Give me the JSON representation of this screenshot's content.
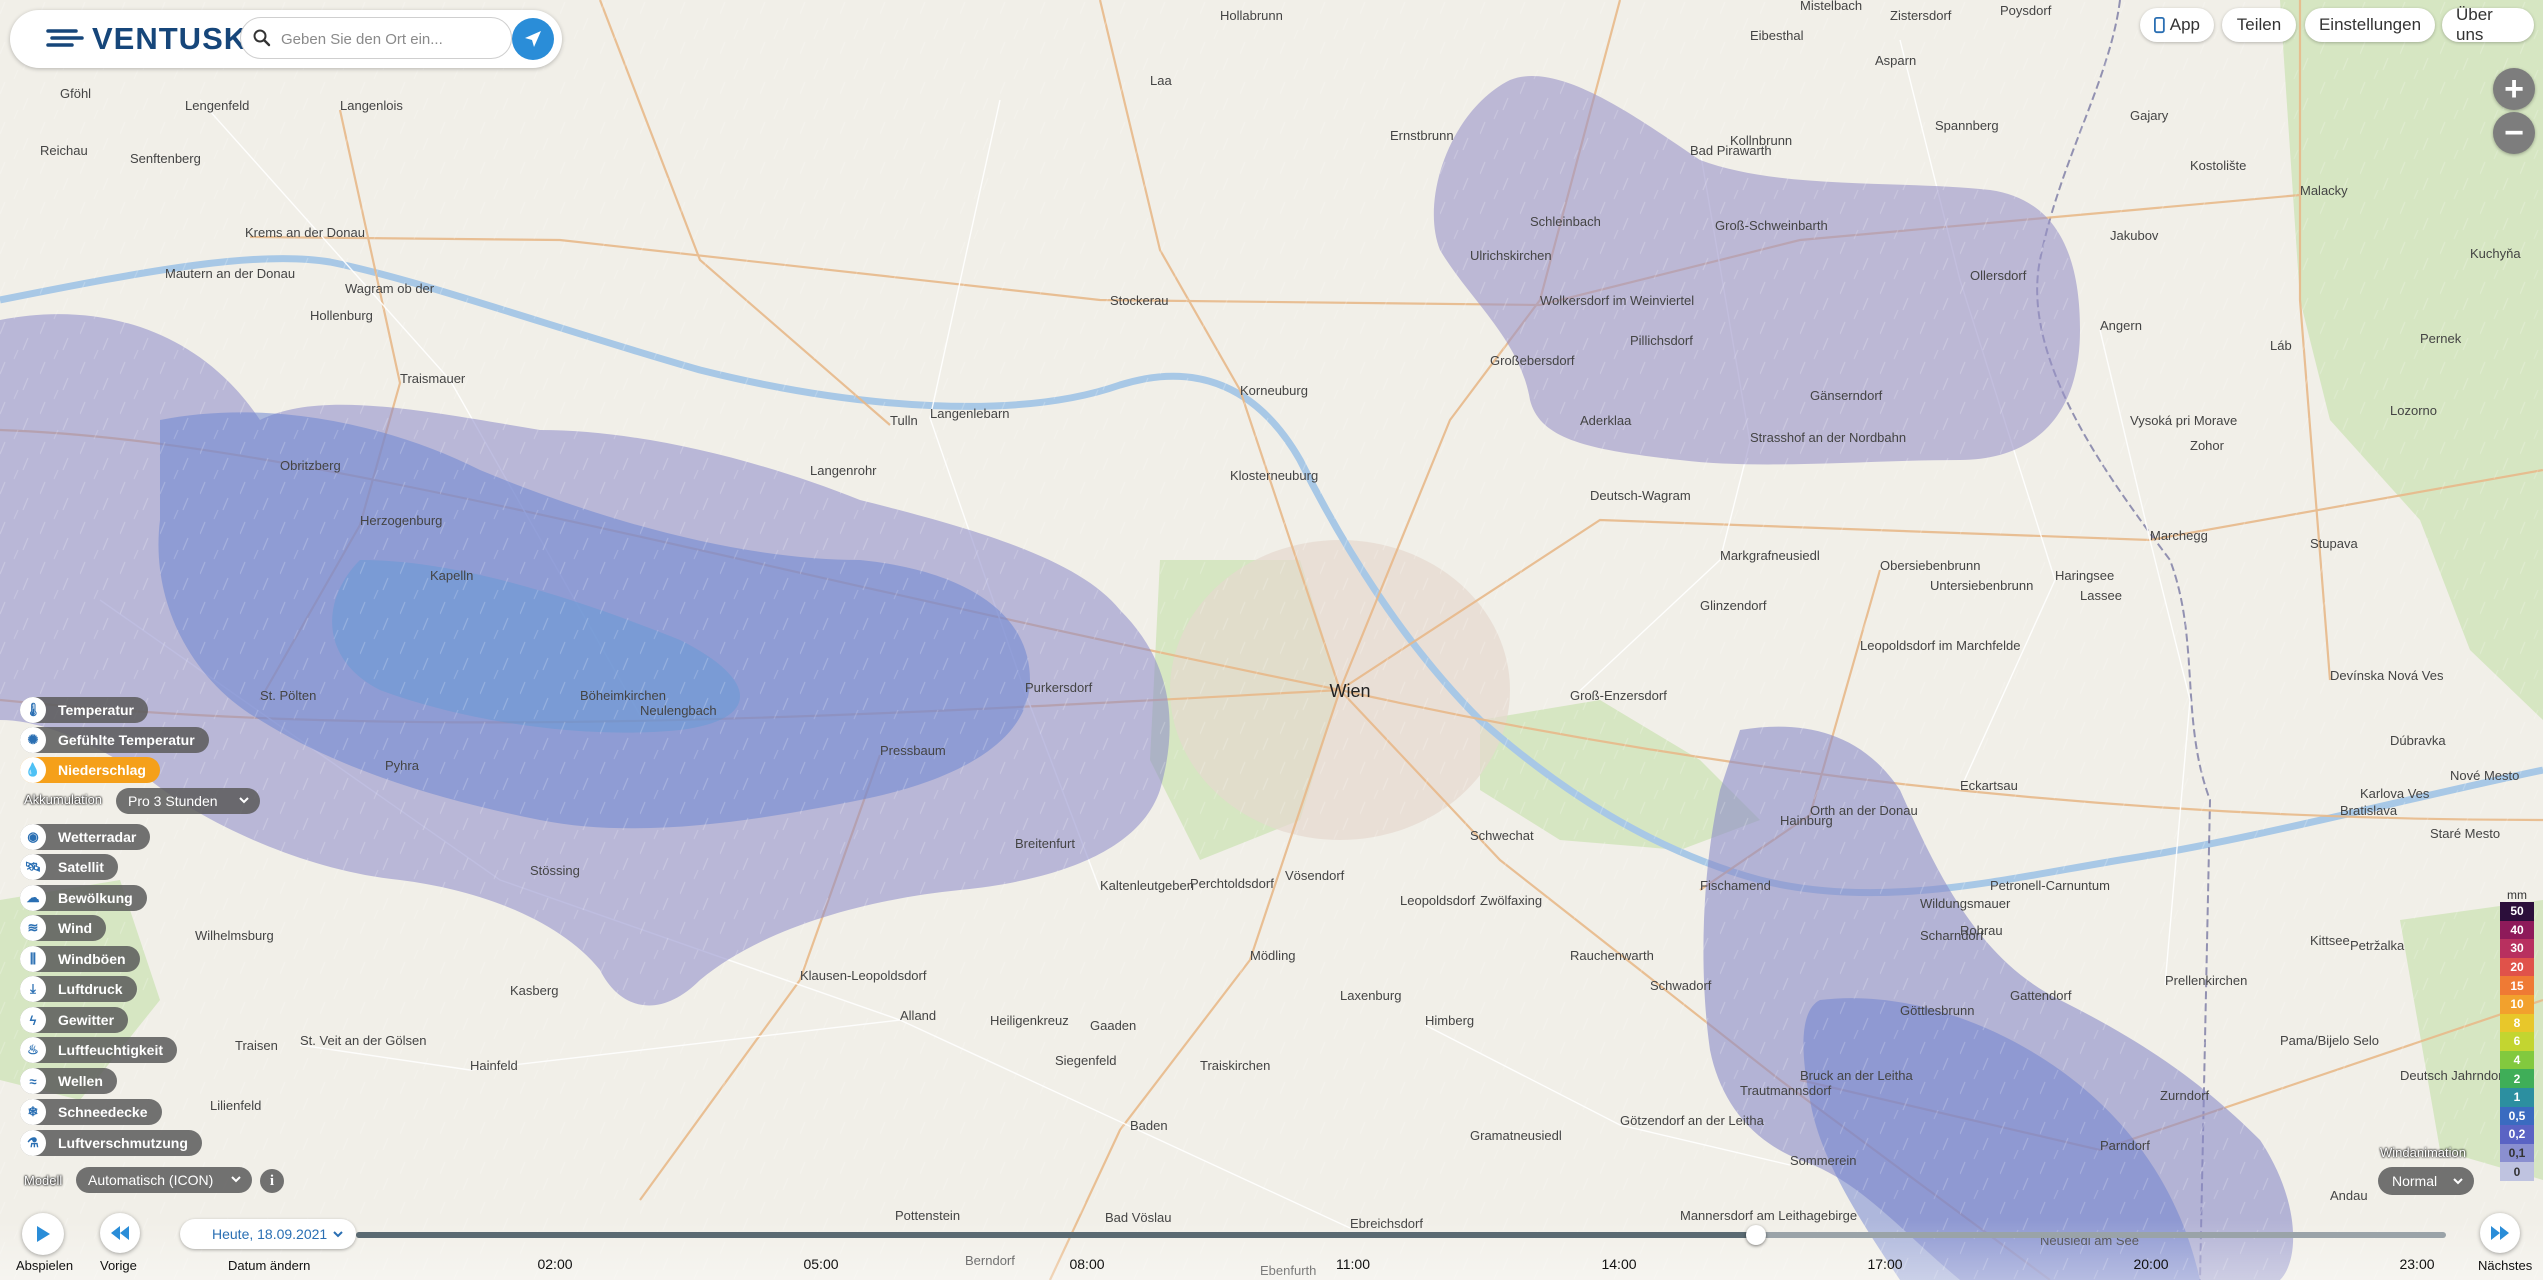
{
  "app": {
    "logo": "VENTUSKY"
  },
  "search": {
    "placeholder": "Geben Sie den Ort ein..."
  },
  "top_buttons": {
    "app": "App",
    "share": "Teilen",
    "settings": "Einstellungen",
    "about": "Über uns"
  },
  "zoom": {
    "in": "+",
    "out": "−"
  },
  "layers": [
    {
      "label": "Temperatur",
      "icon": "thermometer-icon"
    },
    {
      "label": "Gefühlte Temperatur",
      "icon": "feels-like-icon"
    },
    {
      "label": "Niederschlag",
      "icon": "raindrop-icon",
      "active": true
    },
    {
      "label": "Wetterradar",
      "icon": "radar-icon"
    },
    {
      "label": "Satellit",
      "icon": "satellite-icon"
    },
    {
      "label": "Bewölkung",
      "icon": "cloud-icon"
    },
    {
      "label": "Wind",
      "icon": "wind-icon"
    },
    {
      "label": "Windböen",
      "icon": "gust-icon"
    },
    {
      "label": "Luftdruck",
      "icon": "pressure-icon"
    },
    {
      "label": "Gewitter",
      "icon": "lightning-icon"
    },
    {
      "label": "Luftfeuchtigkeit",
      "icon": "humidity-icon"
    },
    {
      "label": "Wellen",
      "icon": "waves-icon"
    },
    {
      "label": "Schneedecke",
      "icon": "snowflake-icon"
    },
    {
      "label": "Luftverschmutzung",
      "icon": "pollution-icon"
    }
  ],
  "accumulation": {
    "label": "Akkumulation",
    "value": "Pro 3 Stunden"
  },
  "model": {
    "label": "Modell",
    "value": "Automatisch (ICON)"
  },
  "legend": {
    "unit": "mm",
    "values": [
      "50",
      "40",
      "30",
      "20",
      "15",
      "10",
      "8",
      "6",
      "4",
      "2",
      "1",
      "0,5",
      "0,2",
      "0,1",
      "0"
    ],
    "colors": [
      "#2b0e3a",
      "#8e1a5a",
      "#b8305f",
      "#e0524a",
      "#ef7a34",
      "#f2a12d",
      "#e8c72a",
      "#c3d530",
      "#82c93e",
      "#3fae58",
      "#2c8fa0",
      "#3a6bc0",
      "#5a63c4",
      "#8a8fd0",
      "#bfc3e0"
    ]
  },
  "wind_animation": {
    "label": "Windanimation",
    "value": "Normal"
  },
  "timeline": {
    "play_label": "Abspielen",
    "prev_label": "Vorige",
    "next_label": "Nächstes",
    "date": "Heute, 18.09.2021",
    "date_change_label": "Datum ändern",
    "ticks": [
      "02:00",
      "05:00",
      "08:00",
      "11:00",
      "14:00",
      "17:00",
      "20:00",
      "23:00"
    ],
    "progress": 0.67
  },
  "map": {
    "city": "Wien",
    "places": [
      [
        "Lengenfeld",
        185,
        110
      ],
      [
        "Langenlois",
        340,
        110
      ],
      [
        "Krems an der Donau",
        245,
        237
      ],
      [
        "Mautern an der Donau",
        165,
        278
      ],
      [
        "Senftenberg",
        130,
        163
      ],
      [
        "Gföhl",
        60,
        98
      ],
      [
        "Reichau",
        40,
        155
      ],
      [
        "Traismauer",
        400,
        383
      ],
      [
        "Herzogenburg",
        360,
        525
      ],
      [
        "Wagram ob der",
        345,
        293
      ],
      [
        "Hollenburg",
        310,
        320
      ],
      [
        "Obritzberg",
        280,
        470
      ],
      [
        "Kapelln",
        430,
        580
      ],
      [
        "St. Pölten",
        260,
        700
      ],
      [
        "Böheimkirchen",
        580,
        700
      ],
      [
        "Pyhra",
        385,
        770
      ],
      [
        "Neulengbach",
        640,
        715
      ],
      [
        "Tulln",
        890,
        425
      ],
      [
        "Langenrohr",
        810,
        475
      ],
      [
        "Langenlebarn",
        930,
        418
      ],
      [
        "Klosterneuburg",
        1230,
        480
      ],
      [
        "Korneuburg",
        1240,
        395
      ],
      [
        "Stockerau",
        1110,
        305
      ],
      [
        "Wolkersdorf im Weinviertel",
        1540,
        305
      ],
      [
        "Deutsch-Wagram",
        1590,
        500
      ],
      [
        "Groß-Enzersdorf",
        1570,
        700
      ],
      [
        "Schwechat",
        1470,
        840
      ],
      [
        "Fischamend",
        1700,
        890
      ],
      [
        "Mödling",
        1250,
        960
      ],
      [
        "Baden",
        1130,
        1130
      ],
      [
        "Bruck an der Leitha",
        1800,
        1080
      ],
      [
        "Hainburg",
        1780,
        825
      ],
      [
        "Bratislava",
        2340,
        815
      ],
      [
        "Petržalka",
        2350,
        950
      ],
      [
        "Marchegg",
        2150,
        540
      ],
      [
        "Malacky",
        2300,
        195
      ],
      [
        "Stupava",
        2310,
        548
      ],
      [
        "Pernek",
        2420,
        343
      ],
      [
        "Purkersdorf",
        1025,
        692
      ],
      [
        "Pressbaum",
        880,
        755
      ],
      [
        "Breitenfurt",
        1015,
        848
      ],
      [
        "Gänserndorf",
        1810,
        400
      ],
      [
        "Laxenburg",
        1340,
        1000
      ],
      [
        "Ebreichsdorf",
        1350,
        1228
      ],
      [
        "Traiskirchen",
        1200,
        1070
      ],
      [
        "Gramatneusiedl",
        1470,
        1140
      ],
      [
        "Hollabrunn",
        1220,
        20
      ],
      [
        "Ernstbrunn",
        1390,
        140
      ],
      [
        "Mistelbach",
        1800,
        10
      ],
      [
        "Laa",
        1150,
        85
      ],
      [
        "Groß-Schweinbarth",
        1715,
        230
      ],
      [
        "Ollersdorf",
        1970,
        280
      ],
      [
        "Zistersdorf",
        1890,
        20
      ],
      [
        "Gajary",
        2130,
        120
      ],
      [
        "Kostolište",
        2190,
        170
      ],
      [
        "Jakubov",
        2110,
        240
      ],
      [
        "Kuchyňa",
        2470,
        258
      ],
      [
        "Lozorno",
        2390,
        415
      ],
      [
        "Zohor",
        2190,
        450
      ],
      [
        "Vysoká pri Morave",
        2130,
        425
      ],
      [
        "Láb",
        2270,
        350
      ],
      [
        "Devínska Nová Ves",
        2330,
        680
      ],
      [
        "Dúbravka",
        2390,
        745
      ],
      [
        "Karlova Ves",
        2360,
        798
      ],
      [
        "Nové Mesto",
        2450,
        780
      ],
      [
        "Staré Mesto",
        2430,
        838
      ],
      [
        "Kittsee",
        2310,
        945
      ],
      [
        "Parndorf",
        2100,
        1150
      ],
      [
        "Neusiedl am See",
        2040,
        1245
      ],
      [
        "Ebenfurth",
        1260,
        1275
      ],
      [
        "Pottenstein",
        895,
        1220
      ],
      [
        "Berndorf",
        965,
        1265
      ],
      [
        "Bad Vöslau",
        1105,
        1222
      ],
      [
        "St. Veit an der Gölsen",
        300,
        1045
      ],
      [
        "Hainfeld",
        470,
        1070
      ],
      [
        "Lilienfeld",
        210,
        1110
      ],
      [
        "Wilhelmsburg",
        195,
        940
      ],
      [
        "Traisen",
        235,
        1050
      ],
      [
        "Kasberg",
        510,
        995
      ],
      [
        "Alland",
        900,
        1020
      ],
      [
        "Heiligenkreuz",
        990,
        1025
      ],
      [
        "Gaaden",
        1090,
        1030
      ],
      [
        "Siegenfeld",
        1055,
        1065
      ],
      [
        "Klausen-Leopoldsdorf",
        800,
        980
      ],
      [
        "Stössing",
        530,
        875
      ],
      [
        "Kaltenleutgeben",
        1100,
        890
      ],
      [
        "Perchtoldsdorf",
        1190,
        888
      ],
      [
        "Vösendorf",
        1285,
        880
      ],
      [
        "Leopoldsdorf",
        1400,
        905
      ],
      [
        "Zwölfaxing",
        1480,
        905
      ],
      [
        "Rauchenwarth",
        1570,
        960
      ],
      [
        "Schwadorf",
        1650,
        990
      ],
      [
        "Himberg",
        1425,
        1025
      ],
      [
        "Mannersdorf am Leithagebirge",
        1680,
        1220
      ],
      [
        "Sommerein",
        1790,
        1165
      ],
      [
        "Trautmannsdorf",
        1740,
        1095
      ],
      [
        "Götzendorf an der Leitha",
        1620,
        1125
      ],
      [
        "Rohrau",
        1960,
        935
      ],
      [
        "Petronell-Carnuntum",
        1990,
        890
      ],
      [
        "Prellenkirchen",
        2165,
        985
      ],
      [
        "Pama/Bijelo Selo",
        2280,
        1045
      ],
      [
        "Deutsch Jahrndorf",
        2400,
        1080
      ],
      [
        "Gattendorf",
        2010,
        1000
      ],
      [
        "Zurndorf",
        2160,
        1100
      ],
      [
        "Andau",
        2330,
        1200
      ],
      [
        "Angern",
        2100,
        330
      ],
      [
        "Eibesthal",
        1750,
        40
      ],
      [
        "Poysdorf",
        2000,
        15
      ],
      [
        "Asparn",
        1875,
        65
      ],
      [
        "Spannberg",
        1935,
        130
      ],
      [
        "Kollnbrunn",
        1730,
        145
      ],
      [
        "Bad Pirawarth",
        1690,
        155
      ],
      [
        "Schleinbach",
        1530,
        226
      ],
      [
        "Ulrichskirchen",
        1470,
        260
      ],
      [
        "Pillichsdorf",
        1630,
        345
      ],
      [
        "Großebersdorf",
        1490,
        365
      ],
      [
        "Aderklaa",
        1580,
        425
      ],
      [
        "Strasshof an der Nordbahn",
        1750,
        442
      ],
      [
        "Markgrafneusiedl",
        1720,
        560
      ],
      [
        "Obersiebenbrunn",
        1880,
        570
      ],
      [
        "Untersiebenbrunn",
        1930,
        590
      ],
      [
        "Glinzendorf",
        1700,
        610
      ],
      [
        "Leopoldsdorf im Marchfelde",
        1860,
        650
      ],
      [
        "Haringsee",
        2055,
        580
      ],
      [
        "Lassee",
        2080,
        600
      ],
      [
        "Eckartsau",
        1960,
        790
      ],
      [
        "Orth an der Donau",
        1810,
        815
      ],
      [
        "Wildungsmauer",
        1920,
        908
      ],
      [
        "Scharndorf",
        1920,
        940
      ],
      [
        "Göttlesbrunn",
        1900,
        1015
      ]
    ]
  }
}
